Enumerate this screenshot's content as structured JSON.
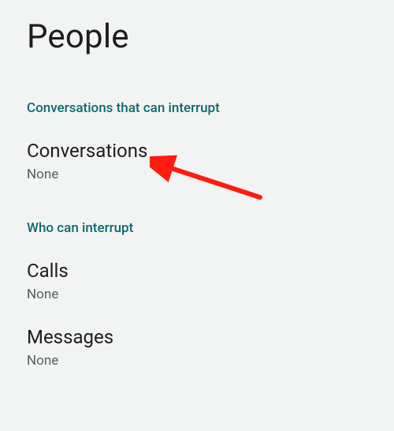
{
  "header": {
    "title": "People"
  },
  "section1": {
    "label": "Conversations that can interrupt",
    "items": [
      {
        "title": "Conversations",
        "value": "None"
      }
    ]
  },
  "section2": {
    "label": "Who can interrupt",
    "items": [
      {
        "title": "Calls",
        "value": "None"
      },
      {
        "title": "Messages",
        "value": "None"
      }
    ]
  },
  "annotation": {
    "arrow_color": "#ff1b0f"
  }
}
